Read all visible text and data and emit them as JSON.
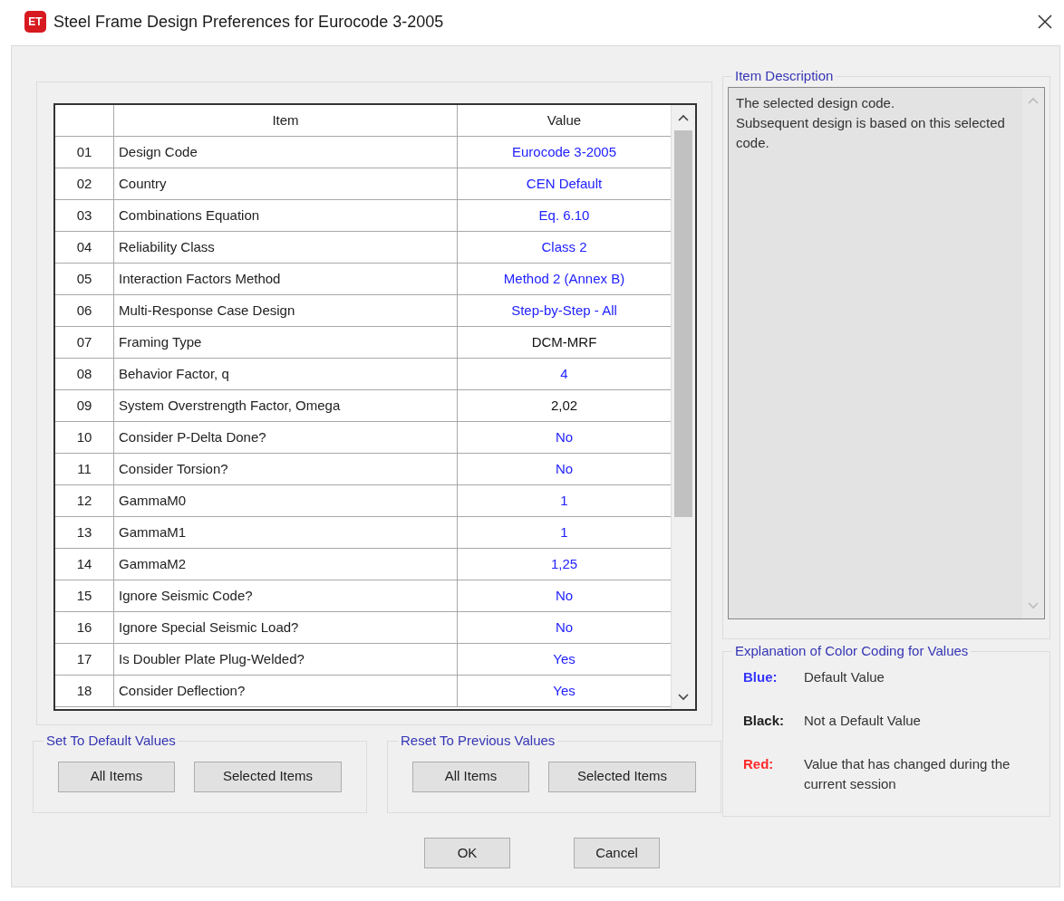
{
  "window": {
    "icon_text": "ET",
    "title": "Steel Frame Design Preferences for Eurocode 3-2005"
  },
  "table": {
    "columns": [
      "Item",
      "Value"
    ],
    "rows": [
      {
        "number": "01",
        "item": "Design Code",
        "value": "Eurocode 3-2005",
        "default": true
      },
      {
        "number": "02",
        "item": "Country",
        "value": "CEN Default",
        "default": true
      },
      {
        "number": "03",
        "item": "Combinations Equation",
        "value": "Eq. 6.10",
        "default": true
      },
      {
        "number": "04",
        "item": "Reliability Class",
        "value": "Class 2",
        "default": true
      },
      {
        "number": "05",
        "item": "Interaction Factors Method",
        "value": "Method 2 (Annex B)",
        "default": true
      },
      {
        "number": "06",
        "item": "Multi-Response Case Design",
        "value": "Step-by-Step - All",
        "default": true
      },
      {
        "number": "07",
        "item": "Framing Type",
        "value": "DCM-MRF",
        "default": false
      },
      {
        "number": "08",
        "item": "Behavior Factor, q",
        "value": "4",
        "default": true
      },
      {
        "number": "09",
        "item": "System Overstrength Factor, Omega",
        "value": "2,02",
        "default": false
      },
      {
        "number": "10",
        "item": "Consider P-Delta Done?",
        "value": "No",
        "default": true
      },
      {
        "number": "11",
        "item": "Consider Torsion?",
        "value": "No",
        "default": true
      },
      {
        "number": "12",
        "item": "GammaM0",
        "value": "1",
        "default": true
      },
      {
        "number": "13",
        "item": "GammaM1",
        "value": "1",
        "default": true
      },
      {
        "number": "14",
        "item": "GammaM2",
        "value": "1,25",
        "default": true
      },
      {
        "number": "15",
        "item": "Ignore Seismic Code?",
        "value": "No",
        "default": true
      },
      {
        "number": "16",
        "item": "Ignore Special Seismic Load?",
        "value": "No",
        "default": true
      },
      {
        "number": "17",
        "item": "Is Doubler Plate Plug-Welded?",
        "value": "Yes",
        "default": true
      },
      {
        "number": "18",
        "item": "Consider Deflection?",
        "value": "Yes",
        "default": true
      }
    ]
  },
  "item_description": {
    "title": "Item Description",
    "text": "The selected design code.\nSubsequent design is based on this selected code."
  },
  "color_coding": {
    "title": "Explanation of Color Coding for Values",
    "items": [
      {
        "label": "Blue:",
        "text": "Default Value",
        "color": "#3333ff"
      },
      {
        "label": "Black:",
        "text": "Not a Default Value",
        "color": "#222222"
      },
      {
        "label": "Red:",
        "text": "Value that has changed during the current session",
        "color": "#ff2a2a"
      }
    ]
  },
  "set_to_default": {
    "title": "Set To Default Values",
    "buttons": [
      "All Items",
      "Selected Items"
    ]
  },
  "reset_to_previous": {
    "title": "Reset To Previous Values",
    "buttons": [
      "All Items",
      "Selected Items"
    ]
  },
  "buttons": [
    "OK",
    "Cancel"
  ]
}
